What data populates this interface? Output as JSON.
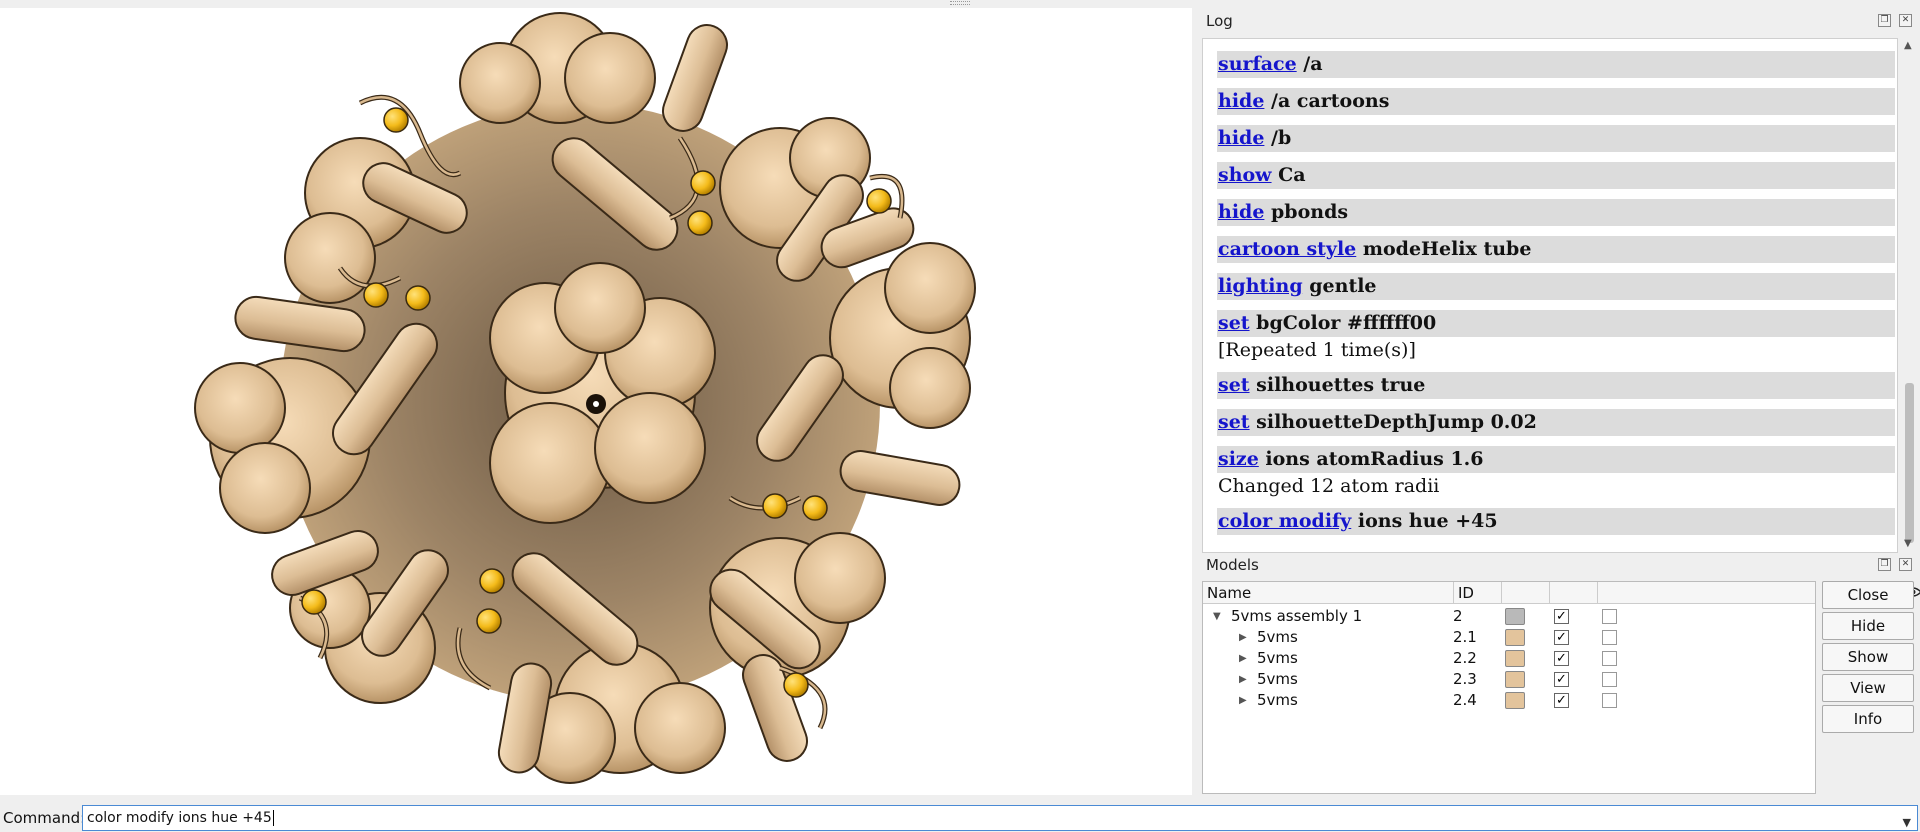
{
  "log": {
    "title": "Log",
    "entries": [
      {
        "cmd": "surface",
        "args": " /a"
      },
      {
        "cmd": "hide",
        "args": " /a cartoons"
      },
      {
        "cmd": "hide",
        "args": " /b"
      },
      {
        "cmd": "show",
        "args": " Ca"
      },
      {
        "cmd": "hide",
        "args": " pbonds"
      },
      {
        "cmd": "cartoon style",
        "args": " modeHelix tube"
      },
      {
        "cmd": "lighting",
        "args": " gentle"
      },
      {
        "cmd": "set",
        "args": " bgColor #ffffff00"
      },
      {
        "cmd": "set",
        "args": " silhouettes true"
      },
      {
        "cmd": "set",
        "args": " silhouetteDepthJump 0.02"
      },
      {
        "cmd": "size",
        "args": " ions atomRadius 1.6"
      },
      {
        "cmd": "color modify",
        "args": " ions hue +45"
      }
    ],
    "repeated_note": "[Repeated 1 time(s)]",
    "changed_note": "Changed 12 atom radii"
  },
  "models": {
    "title": "Models",
    "columns": {
      "name": "Name",
      "id": "ID"
    },
    "rows": [
      {
        "name": "5vms assembly 1",
        "id": "2",
        "color": "#b9b9b9",
        "shown": "✓"
      },
      {
        "name": "5vms",
        "id": "2.1",
        "color": "#e3c49c",
        "shown": "✓"
      },
      {
        "name": "5vms",
        "id": "2.2",
        "color": "#e3c49c",
        "shown": "✓"
      },
      {
        "name": "5vms",
        "id": "2.3",
        "color": "#e3c49c",
        "shown": "✓"
      },
      {
        "name": "5vms",
        "id": "2.4",
        "color": "#e3c49c",
        "shown": "✓"
      }
    ],
    "buttons": [
      "Close",
      "Hide",
      "Show",
      "View",
      "Info"
    ]
  },
  "command": {
    "label": "Command:",
    "value": "color modify ions hue +45"
  },
  "colors": {
    "protein": "#e3c49c",
    "ion": "#f4bb1a",
    "link": "#1515cc"
  }
}
